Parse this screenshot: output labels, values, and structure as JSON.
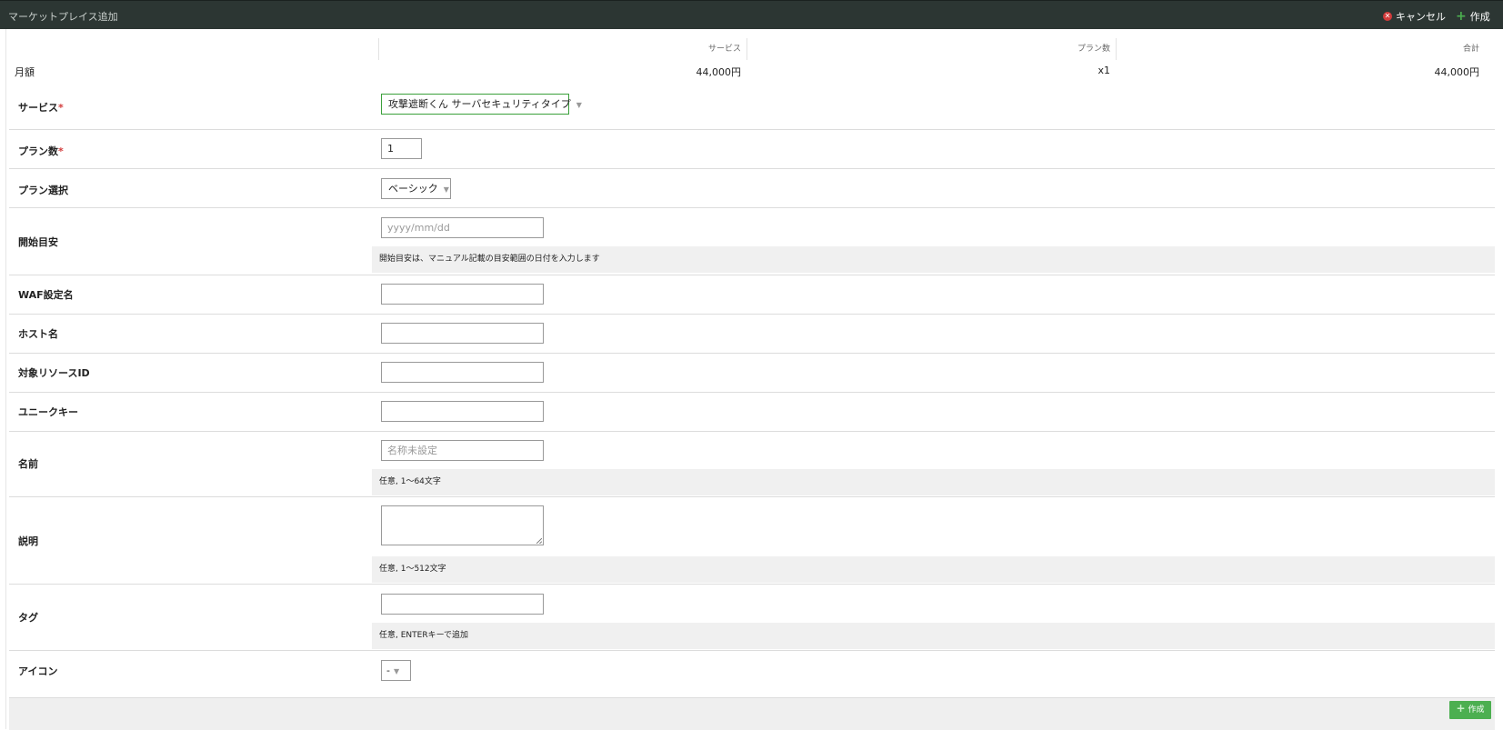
{
  "titlebar": {
    "title": "マーケットプレイス追加",
    "cancel_label": "キャンセル",
    "create_label": "作成"
  },
  "summary": {
    "row_label": "月額",
    "columns": [
      {
        "header": "サービス",
        "value": "44,000円"
      },
      {
        "header": "プラン数",
        "value": "x1"
      },
      {
        "header": "合計",
        "value": "44,000円"
      }
    ]
  },
  "form": {
    "service": {
      "label": "サービス",
      "required_mark": "*",
      "value": "攻撃遮断くん サーバセキュリティタイプ"
    },
    "plan_count": {
      "label": "プラン数",
      "required_mark": "*",
      "value": "1"
    },
    "plan_select": {
      "label": "プラン選択",
      "value": "ベーシック"
    },
    "start_date": {
      "label": "開始目安",
      "placeholder": "yyyy/mm/dd",
      "hint": "開始目安は、マニュアル記載の目安範囲の日付を入力します"
    },
    "waf_name": {
      "label": "WAF設定名",
      "value": ""
    },
    "host_name": {
      "label": "ホスト名",
      "value": ""
    },
    "resource_id": {
      "label": "対象リソースID",
      "value": ""
    },
    "unique_key": {
      "label": "ユニークキー",
      "value": ""
    },
    "name": {
      "label": "名前",
      "placeholder": "名称未設定",
      "hint": "任意, 1〜64文字"
    },
    "description": {
      "label": "説明",
      "value": "",
      "hint": "任意, 1〜512文字"
    },
    "tags": {
      "label": "タグ",
      "value": "",
      "hint": "任意, ENTERキーで追加"
    },
    "icon": {
      "label": "アイコン",
      "value": "-"
    }
  },
  "footer": {
    "create_label": "作成"
  },
  "colors": {
    "titlebar_bg": "#2c3633",
    "accent_green": "#4caf50",
    "required_red": "#d23b3b",
    "select_focus_border": "#3aa03a"
  }
}
